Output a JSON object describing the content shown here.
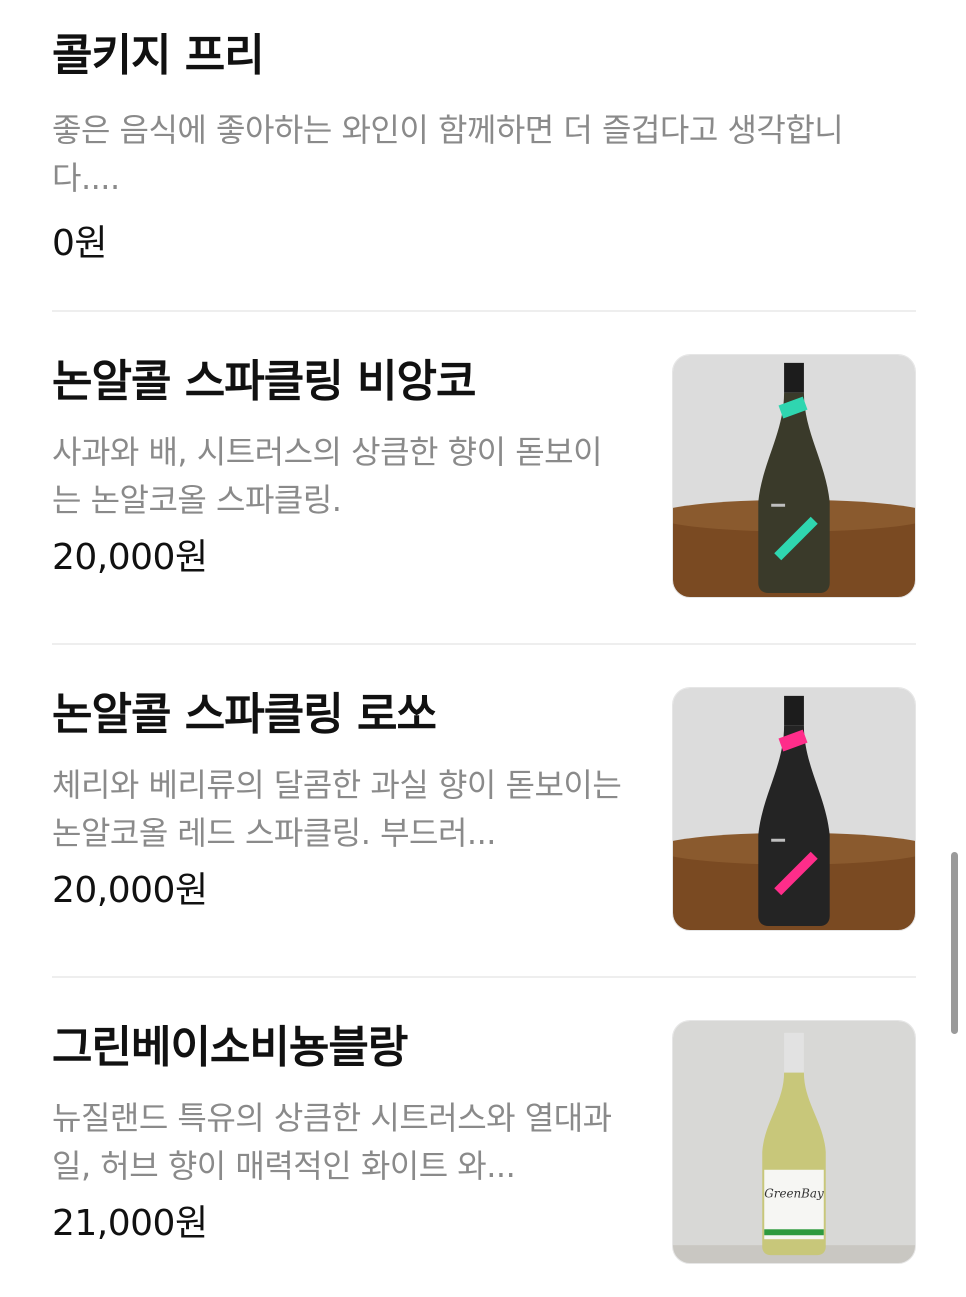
{
  "items": [
    {
      "name": "콜키지 프리",
      "description": "좋은 음식에 좋아하는 와인이 함께하면 더 즐겁다고 생각합니다....",
      "price": "0원"
    },
    {
      "name": "논알콜 스파클링 비앙코",
      "description": "사과와 배, 시트러스의 상큼한 향이 돋보이는 논알코올 스파클링.",
      "price": "20,000원",
      "image_icon": "sparkling-wine-bottle-green-label",
      "label_color": "#2fd6b0"
    },
    {
      "name": "논알콜 스파클링 로쏘",
      "description": "체리와 베리류의 달콤한 과실 향이 돋보이는 논알코올 레드 스파클링. 부드러...",
      "price": "20,000원",
      "image_icon": "sparkling-wine-bottle-pink-label",
      "label_color": "#ff2d8a"
    },
    {
      "name": "그린베이소비뇽블랑",
      "description": "뉴질랜드 특유의 상큼한 시트러스와 열대과일, 허브 향이 매력적인 화이트 와...",
      "price": "21,000원",
      "image_icon": "white-wine-bottle",
      "label_text": "GreenBay"
    }
  ],
  "colors": {
    "divider": "#eeeeee",
    "description": "#8a8a8a",
    "text": "#111111"
  }
}
